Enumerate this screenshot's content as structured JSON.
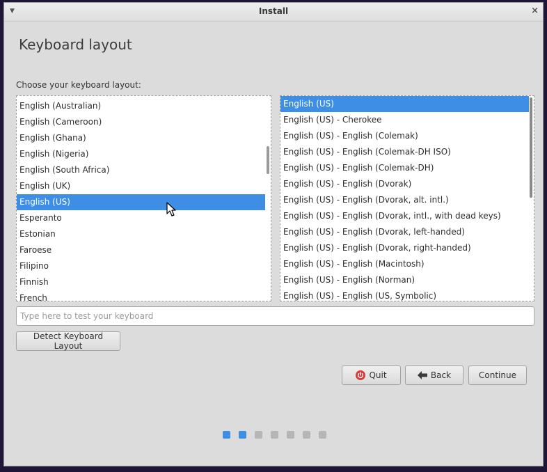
{
  "window": {
    "title": "Install",
    "menu_icon": "chevron-down-icon",
    "close_label": "×"
  },
  "page": {
    "heading": "Keyboard layout",
    "prompt": "Choose your keyboard layout:"
  },
  "layouts": {
    "items": [
      "English (Australian)",
      "English (Cameroon)",
      "English (Ghana)",
      "English (Nigeria)",
      "English (South Africa)",
      "English (UK)",
      "English (US)",
      "Esperanto",
      "Estonian",
      "Faroese",
      "Filipino",
      "Finnish",
      "French"
    ],
    "selected": "English (US)"
  },
  "variants": {
    "items": [
      "English (US)",
      "English (US) - Cherokee",
      "English (US) - English (Colemak)",
      "English (US) - English (Colemak-DH ISO)",
      "English (US) - English (Colemak-DH)",
      "English (US) - English (Dvorak)",
      "English (US) - English (Dvorak, alt. intl.)",
      "English (US) - English (Dvorak, intl., with dead keys)",
      "English (US) - English (Dvorak, left-handed)",
      "English (US) - English (Dvorak, right-handed)",
      "English (US) - English (Macintosh)",
      "English (US) - English (Norman)",
      "English (US) - English (US, Symbolic)"
    ],
    "selected": "English (US)"
  },
  "test_field": {
    "value": "",
    "placeholder": "Type here to test your keyboard"
  },
  "buttons": {
    "detect": "Detect Keyboard Layout",
    "quit": "Quit",
    "back": "Back",
    "continue": "Continue"
  },
  "progress": {
    "total_steps": 7,
    "completed_steps": 2
  },
  "colors": {
    "accent": "#3d8ee4",
    "quit_icon": "#d63a3a",
    "window_bg": "#dcdcdc"
  },
  "icons": {
    "quit": "power-icon",
    "back": "arrow-left-icon"
  }
}
